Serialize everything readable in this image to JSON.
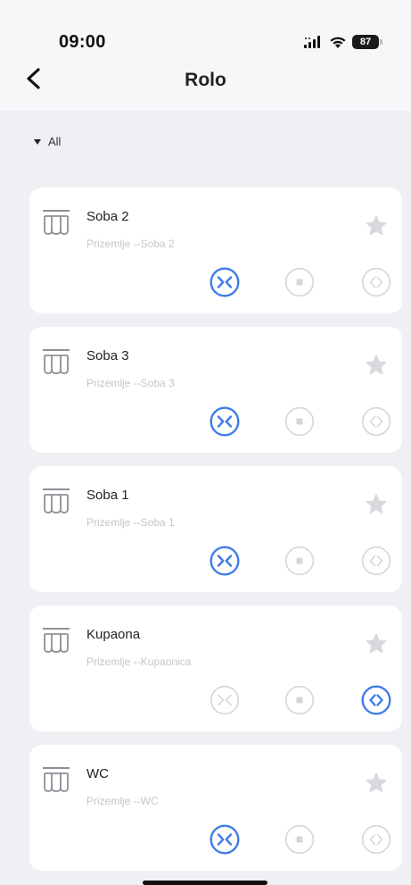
{
  "status_bar": {
    "time": "09:00",
    "battery": "87"
  },
  "nav": {
    "title": "Rolo"
  },
  "filter": {
    "label": "All"
  },
  "colors": {
    "active": "#3f7ce8",
    "inactive": "#d3d6db",
    "star": "#d7d9dd"
  },
  "devices": [
    {
      "name": "Soba 2",
      "location": "Prizemlje --Soba 2",
      "active_button": "close"
    },
    {
      "name": "Soba 3",
      "location": "Prizemlje --Soba 3",
      "active_button": "close"
    },
    {
      "name": "Soba 1",
      "location": "Prizemlje --Soba 1",
      "active_button": "close"
    },
    {
      "name": "Kupaona",
      "location": "Prizemlje --Kupaonica",
      "active_button": "open"
    },
    {
      "name": "WC",
      "location": "Prizemlje --WC",
      "active_button": "close"
    }
  ]
}
